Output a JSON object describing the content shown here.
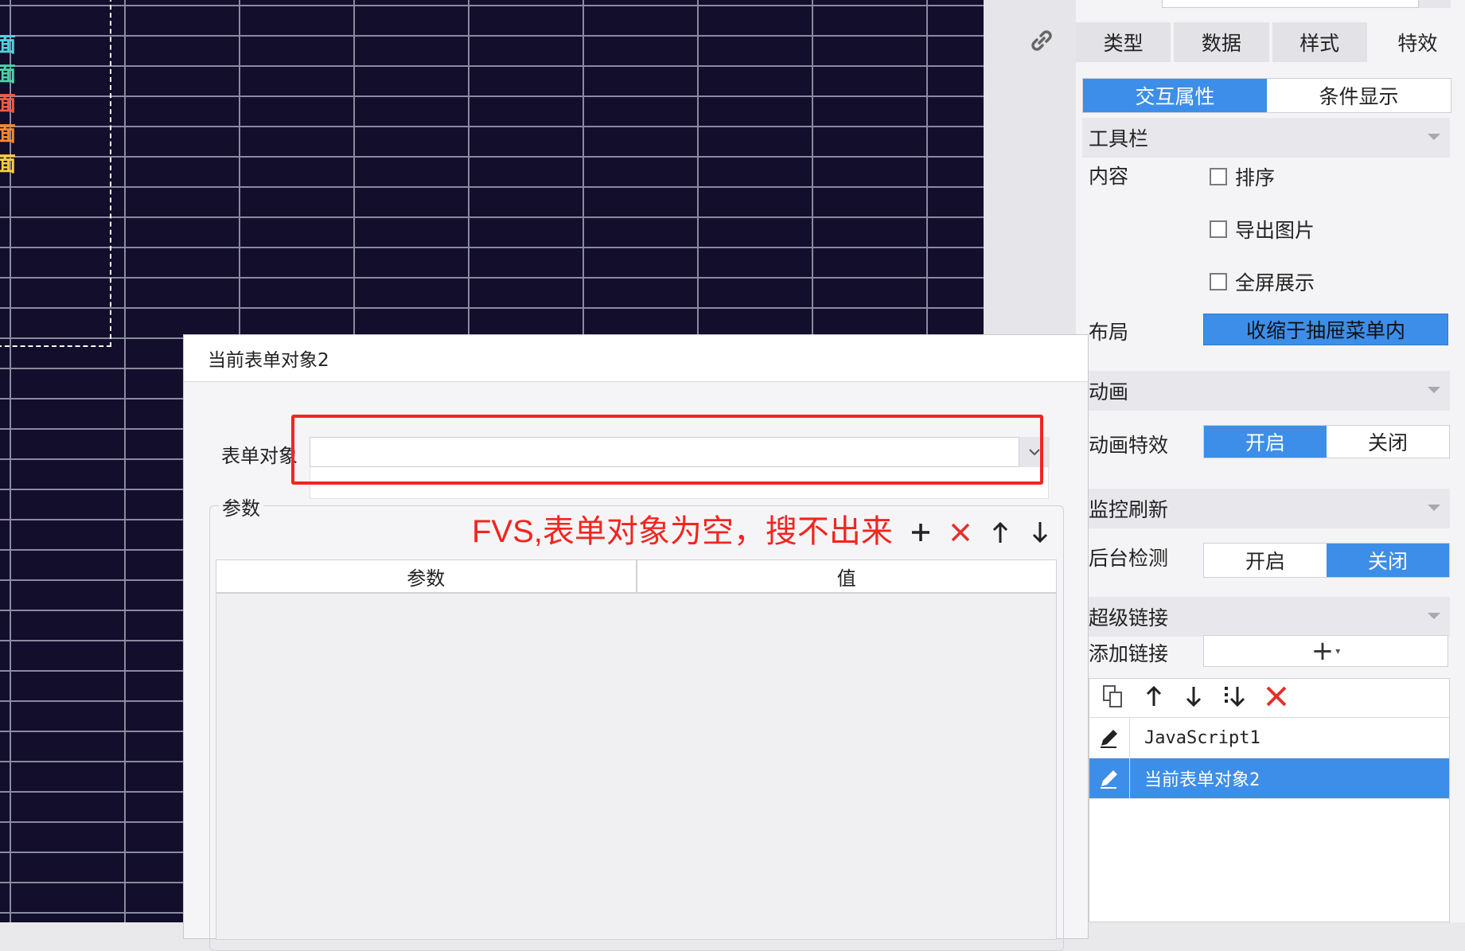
{
  "canvas": {
    "edge_labels": [
      {
        "text": "面",
        "color": "#4fd4e0"
      },
      {
        "text": "面",
        "color": "#4ad6a8"
      },
      {
        "text": "面",
        "color": "#ff5a3c"
      },
      {
        "text": "面",
        "color": "#ff8a2a"
      },
      {
        "text": "面",
        "color": "#ffcf3a"
      }
    ]
  },
  "right_panel": {
    "tabs": [
      "类型",
      "数据",
      "样式",
      "特效"
    ],
    "subtabs": [
      "交互属性",
      "条件显示"
    ],
    "toolbar_section": {
      "title": "工具栏",
      "content_label": "内容",
      "options": [
        "排序",
        "导出图片",
        "全屏展示"
      ],
      "layout_label": "布局",
      "layout_value": "收缩于抽屉菜单内"
    },
    "animation_section": {
      "title": "动画",
      "effect_label": "动画特效",
      "on": "开启",
      "off": "关闭"
    },
    "monitor_section": {
      "title": "监控刷新",
      "detect_label": "后台检测",
      "on": "开启",
      "off": "关闭"
    },
    "hyperlink_section": {
      "title": "超级链接",
      "add_label": "添加链接",
      "add_symbol": "+",
      "add_caret": "▾",
      "items": [
        "JavaScript1",
        "当前表单对象2"
      ]
    }
  },
  "dialog": {
    "title": "当前表单对象2",
    "form_object_label": "表单对象",
    "form_object_value": "",
    "params_label": "参数",
    "annotation": "FVS,表单对象为空，搜不出来",
    "table_headers": [
      "参数",
      "值"
    ]
  },
  "colors": {
    "accent": "#3d8ee8",
    "annotation_red": "#f0261f",
    "canvas_bg": "#120e2c"
  }
}
